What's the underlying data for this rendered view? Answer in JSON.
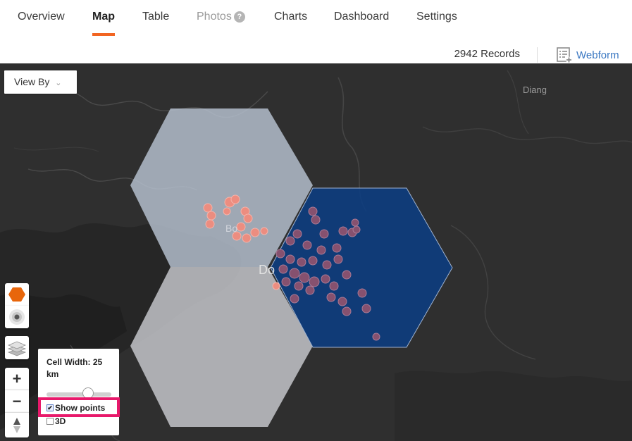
{
  "nav": {
    "tabs": [
      {
        "label": "Overview",
        "state": "normal"
      },
      {
        "label": "Map",
        "state": "active"
      },
      {
        "label": "Table",
        "state": "normal"
      },
      {
        "label": "Photos",
        "state": "disabled"
      },
      {
        "label": "Charts",
        "state": "normal"
      },
      {
        "label": "Dashboard",
        "state": "normal"
      },
      {
        "label": "Settings",
        "state": "normal"
      }
    ],
    "help_glyph": "?",
    "accent_color": "#f26522"
  },
  "subbar": {
    "records_label": "2942 Records",
    "webform_label": "Webform",
    "webform_icon": "form-add-icon"
  },
  "map": {
    "view_by_label": "View By",
    "view_by_chevron": "⌄",
    "place_labels": [
      "Diang",
      "Bo",
      "Do"
    ],
    "hex_colors": {
      "light": "#b8c3d2",
      "mid": "#c9cbd0",
      "dark": "#0d3d80"
    },
    "point_colors": {
      "light_cluster": "#ec8d80",
      "dark_cluster": "#86516f"
    },
    "controls": {
      "hexbin_icon": "hexagon-icon",
      "heatmap_icon": "radial-target-icon",
      "layers_icon": "layers-icon",
      "zoom_in": "+",
      "zoom_out": "−",
      "compass_icon": "compass-icon"
    }
  },
  "cell_panel": {
    "title": "Cell Width: 25 km",
    "slider_value_km": 25,
    "show_points_label": "Show points",
    "show_points_checked": true,
    "three_d_label": "3D",
    "three_d_checked": false
  }
}
